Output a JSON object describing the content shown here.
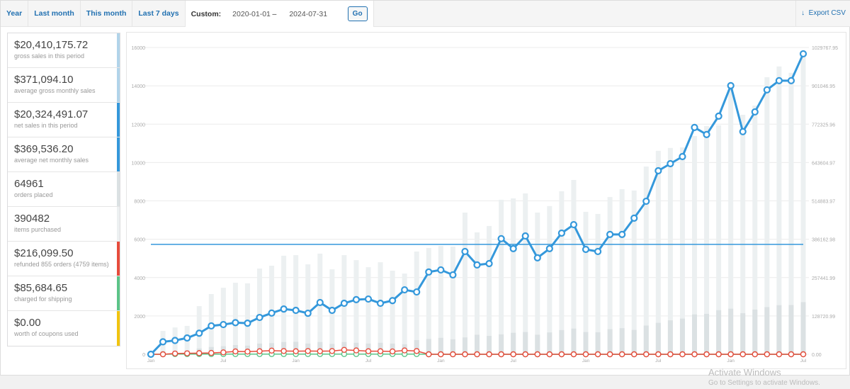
{
  "tabs": [
    {
      "label": "Year"
    },
    {
      "label": "Last month"
    },
    {
      "label": "This month"
    },
    {
      "label": "Last 7 days"
    }
  ],
  "custom": {
    "label": "Custom:",
    "from": "2020-01-01",
    "separator": "–",
    "to": "2024-07-31",
    "go_label": "Go"
  },
  "export": {
    "icon": "download-arrow-icon",
    "label": "Export CSV"
  },
  "legend": [
    {
      "value": "$20,410,175.72",
      "desc": "gross sales in this period",
      "color": "#b1d4ea"
    },
    {
      "value": "$371,094.10",
      "desc": "average gross monthly sales",
      "color": "#b1d4ea"
    },
    {
      "value": "$20,324,491.07",
      "desc": "net sales in this period",
      "color": "#3498db"
    },
    {
      "value": "$369,536.20",
      "desc": "average net monthly sales",
      "color": "#3498db"
    },
    {
      "value": "64961",
      "desc": "orders placed",
      "color": "#dbe1e3"
    },
    {
      "value": "390482",
      "desc": "items purchased",
      "color": "#ecf0f1"
    },
    {
      "value": "$216,099.50",
      "desc": "refunded 855 orders (4759 items)",
      "color": "#e74c3c"
    },
    {
      "value": "$85,684.65",
      "desc": "charged for shipping",
      "color": "#5cc488"
    },
    {
      "value": "$0.00",
      "desc": "worth of coupons used",
      "color": "#f1c40f"
    }
  ],
  "watermark": {
    "title": "Activate Windows",
    "subtitle": "Go to Settings to activate Windows."
  },
  "chart_data": {
    "type": "bar",
    "title": "",
    "x_start": "2020-01",
    "x_end": "2024-07",
    "x_tick_labels": [
      "Jan",
      "Jul",
      "Jan",
      "Jul",
      "Jan",
      "Jul",
      "Jan",
      "Jul",
      "Jan",
      "Jul"
    ],
    "x_tick_indices": [
      0,
      6,
      12,
      18,
      24,
      30,
      36,
      42,
      48,
      54
    ],
    "y_left": {
      "min": 0,
      "max": 16000,
      "ticks": [
        0,
        2000,
        4000,
        6000,
        8000,
        10000,
        12000,
        14000,
        16000
      ]
    },
    "y_right": {
      "min": 0,
      "max": 1029767.95,
      "ticks": [
        "0.00",
        "128720.99",
        "257441.99",
        "386162.98",
        "514883.97",
        "643604.97",
        "772325.96",
        "901046.95",
        "1029767.95"
      ]
    },
    "grid": true,
    "series": [
      {
        "name": "items purchased (bars, left axis)",
        "kind": "bar",
        "color": "#ecf0f1",
        "values": [
          0,
          1220,
          1400,
          1480,
          2510,
          3140,
          3470,
          3730,
          3700,
          4470,
          4620,
          5140,
          5170,
          4690,
          5250,
          4430,
          5170,
          4910,
          4540,
          4800,
          4360,
          4210,
          5360,
          5540,
          5650,
          5620,
          7390,
          6360,
          6690,
          8060,
          8130,
          8390,
          7390,
          7730,
          8500,
          9090,
          7430,
          7320,
          8200,
          8610,
          8540,
          9790,
          10610,
          10760,
          10790,
          11380,
          11900,
          11940,
          13930,
          12490,
          12970,
          14450,
          15010,
          14680,
          15820
        ]
      },
      {
        "name": "orders placed (bars, left axis)",
        "kind": "bar",
        "color": "#dbe1e3",
        "values": [
          0,
          150,
          180,
          200,
          300,
          380,
          420,
          480,
          450,
          560,
          580,
          640,
          650,
          560,
          640,
          540,
          640,
          600,
          560,
          600,
          560,
          520,
          740,
          800,
          860,
          780,
          880,
          1020,
          960,
          1040,
          1120,
          1160,
          1020,
          1140,
          1260,
          1340,
          1160,
          1150,
          1310,
          1360,
          1270,
          1500,
          1640,
          1770,
          1860,
          2080,
          2110,
          2300,
          2380,
          2140,
          2330,
          2460,
          2560,
          2570,
          2720
        ]
      },
      {
        "name": "net sales (line, left-scale units)",
        "kind": "line",
        "color": "#3498db",
        "values": [
          0,
          650,
          720,
          850,
          1100,
          1480,
          1550,
          1650,
          1620,
          1920,
          2150,
          2360,
          2290,
          2140,
          2700,
          2290,
          2660,
          2850,
          2880,
          2660,
          2800,
          3360,
          3250,
          4290,
          4400,
          4140,
          5360,
          4660,
          4730,
          6030,
          5510,
          6170,
          5030,
          5510,
          6320,
          6760,
          5470,
          5360,
          6250,
          6250,
          7100,
          7980,
          9570,
          9940,
          10310,
          11830,
          11460,
          12420,
          14010,
          11610,
          12640,
          13790,
          14270,
          14270,
          15670
        ]
      },
      {
        "name": "average net monthly sales",
        "kind": "hline",
        "color": "#3498db",
        "value": 5730
      },
      {
        "name": "refunds",
        "kind": "line",
        "color": "#e74c3c",
        "values": [
          0,
          0,
          40,
          50,
          60,
          70,
          100,
          150,
          140,
          160,
          190,
          170,
          160,
          170,
          160,
          170,
          230,
          200,
          160,
          160,
          150,
          200,
          170,
          0,
          0,
          0,
          0,
          0,
          0,
          0,
          0,
          0,
          0,
          0,
          0,
          0,
          0,
          0,
          0,
          0,
          0,
          0,
          0,
          0,
          0,
          0,
          0,
          0,
          0,
          0,
          0,
          0,
          0,
          0,
          0
        ]
      },
      {
        "name": "shipping",
        "kind": "line",
        "color": "#5cc488",
        "values": [
          0,
          0,
          10,
          10,
          10,
          10,
          10,
          10,
          10,
          10,
          10,
          10,
          10,
          10,
          10,
          10,
          10,
          10,
          10,
          10,
          10,
          10,
          10,
          0,
          0,
          0,
          0,
          0,
          0,
          0,
          0,
          0,
          0,
          0,
          0,
          0,
          0,
          0,
          0,
          0,
          0,
          0,
          0,
          0,
          0,
          0,
          0,
          0,
          0,
          0,
          0,
          0,
          0,
          0,
          0
        ]
      }
    ]
  }
}
